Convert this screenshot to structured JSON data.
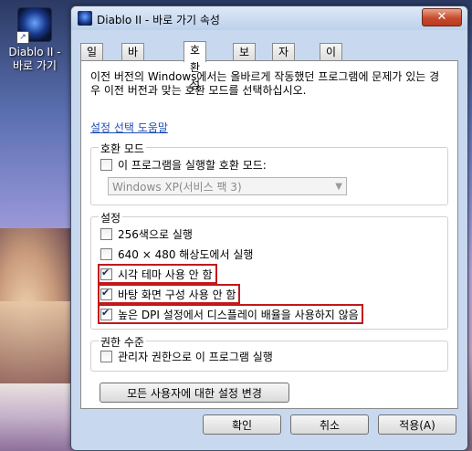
{
  "desktop": {
    "icon_label_line1": "Diablo II -",
    "icon_label_line2": "바로 가기"
  },
  "window": {
    "title": "Diablo II - 바로 가기 속성",
    "close_symbol": "✕"
  },
  "tabs": [
    {
      "label": "일반"
    },
    {
      "label": "바로 가기"
    },
    {
      "label": "호환성"
    },
    {
      "label": "보안"
    },
    {
      "label": "자세히"
    },
    {
      "label": "이전 버전"
    }
  ],
  "intro_text": "이전 버전의 Windows에서는 올바르게 작동했던 프로그램에 문제가 있는 경우 이전 버전과 맞는 호환 모드를 선택하십시오.",
  "help_link": "설정 선택 도움말",
  "compat_group": {
    "title": "호환 모드",
    "checkbox_label": "이 프로그램을 실행할 호환 모드:",
    "checked": false,
    "select_value": "Windows XP(서비스 팩 3)"
  },
  "settings_group": {
    "title": "설정",
    "items": [
      {
        "label": "256색으로 실행",
        "checked": false,
        "highlighted": false
      },
      {
        "label": "640 × 480 해상도에서 실행",
        "checked": false,
        "highlighted": false
      },
      {
        "label": "시각 테마 사용 안 함",
        "checked": true,
        "highlighted": true
      },
      {
        "label": "바탕 화면 구성 사용 안 함",
        "checked": true,
        "highlighted": true
      },
      {
        "label": "높은 DPI 설정에서 디스플레이 배율을 사용하지 않음",
        "checked": true,
        "highlighted": true
      }
    ]
  },
  "privilege_group": {
    "title": "권한 수준",
    "checkbox_label": "관리자 권한으로 이 프로그램 실행",
    "checked": false
  },
  "all_users_button": "모든 사용자에 대한 설정 변경",
  "buttons": {
    "ok": "확인",
    "cancel": "취소",
    "apply": "적용(A)"
  },
  "colors": {
    "highlight_border": "#c2181b",
    "link": "#1f4fb5"
  }
}
